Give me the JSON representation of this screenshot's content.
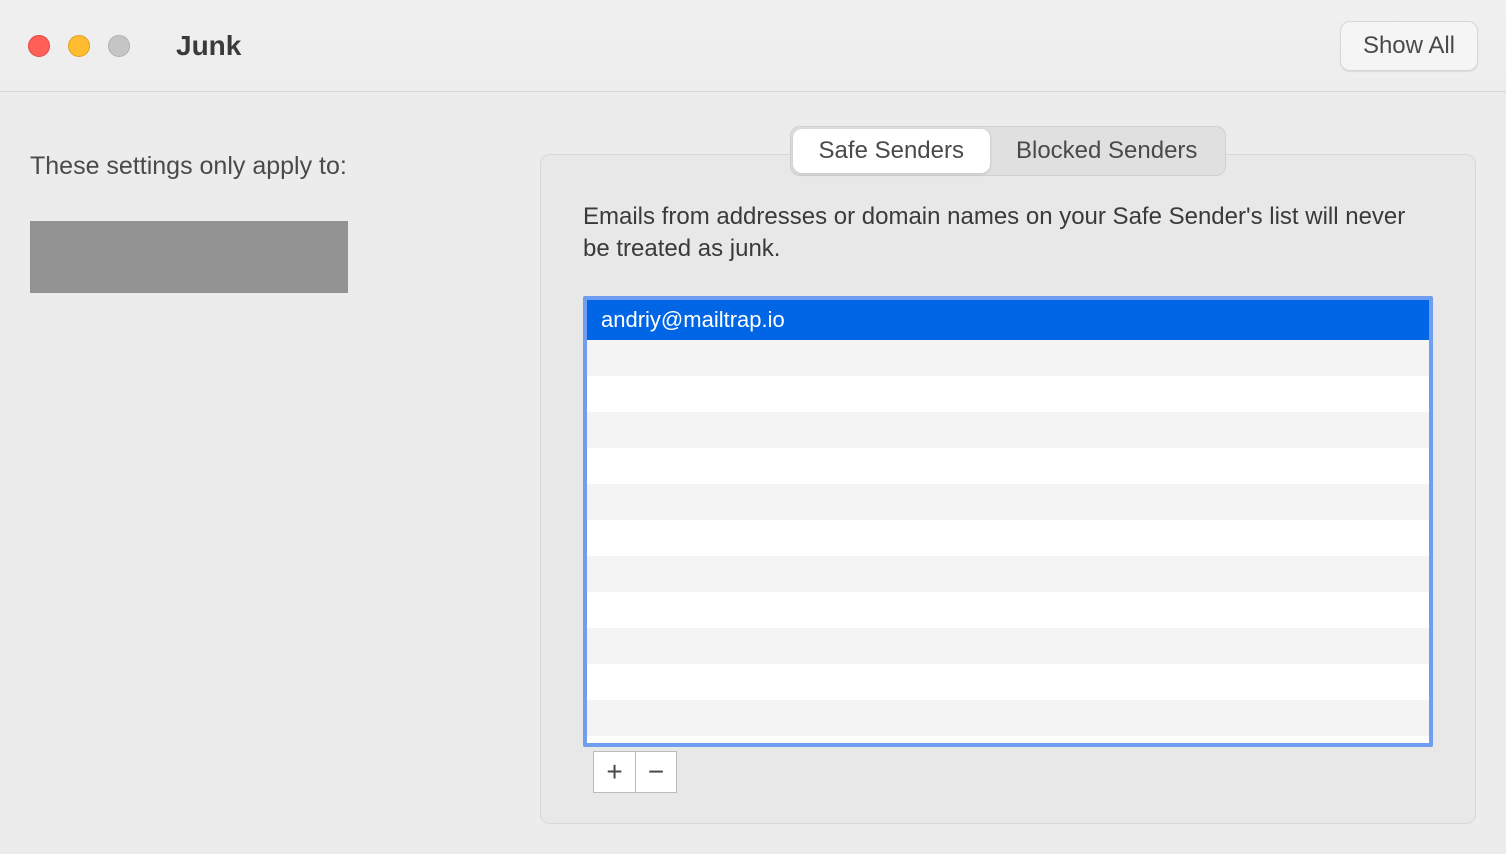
{
  "titlebar": {
    "title": "Junk",
    "show_all_label": "Show All"
  },
  "left_panel": {
    "apply_text": "These settings only apply to:"
  },
  "tabs": {
    "safe_senders": "Safe Senders",
    "blocked_senders": "Blocked Senders",
    "active": "safe_senders"
  },
  "description": "Emails from addresses or domain names on your Safe Sender's list will never be treated as junk.",
  "sender_list": {
    "items": [
      {
        "email": "andriy@mailtrap.io",
        "selected": true
      }
    ]
  },
  "buttons": {
    "add": "+",
    "remove": "−"
  }
}
